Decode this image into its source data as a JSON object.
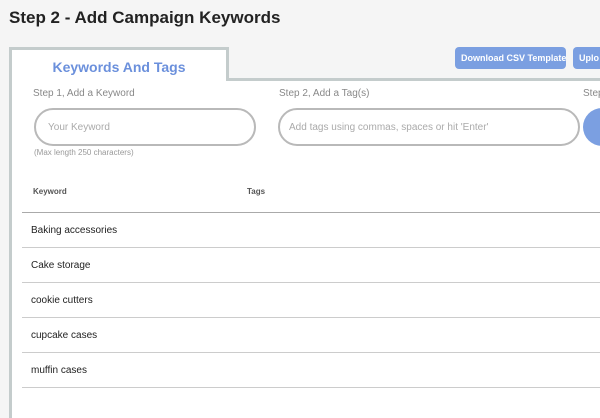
{
  "page": {
    "title": "Step 2 - Add Campaign Keywords"
  },
  "tabs": {
    "active_label": "Keywords And Tags"
  },
  "toolbar": {
    "download_csv_label": "Download CSV Template",
    "upload_label": "Uplo"
  },
  "form": {
    "keyword_label": "Step 1, Add a Keyword",
    "keyword_placeholder": "Your Keyword",
    "keyword_hint": "(Max length 250 characters)",
    "tags_label": "Step 2, Add a Tag(s)",
    "tags_placeholder": "Add tags using commas, spaces or hit 'Enter'",
    "step3_label": "Step"
  },
  "table": {
    "columns": [
      "Keyword",
      "Tags"
    ],
    "rows": [
      {
        "keyword": "Baking accessories",
        "tags": ""
      },
      {
        "keyword": "Cake storage",
        "tags": ""
      },
      {
        "keyword": "cookie cutters",
        "tags": ""
      },
      {
        "keyword": "cupcake cases",
        "tags": ""
      },
      {
        "keyword": "muffin cases",
        "tags": ""
      }
    ]
  },
  "colors": {
    "accent": "#7b9fe1",
    "tab_text": "#6b90dc",
    "border": "#c4cccc"
  }
}
